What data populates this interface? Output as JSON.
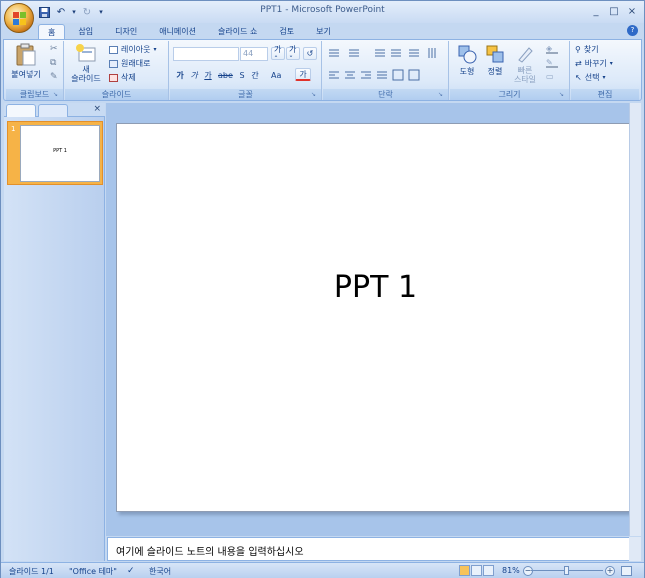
{
  "window": {
    "title": "PPT1 - Microsoft PowerPoint",
    "controls": {
      "minimize": "_",
      "maximize": "□",
      "close": "×"
    }
  },
  "qat": {
    "save": "save-icon",
    "undo": "↶",
    "undo_arrow": "▾",
    "redo": "↻",
    "customize": "▾"
  },
  "tabs": [
    {
      "label": "홈",
      "active": true
    },
    {
      "label": "삽입"
    },
    {
      "label": "디자인"
    },
    {
      "label": "애니메이션"
    },
    {
      "label": "슬라이드 쇼"
    },
    {
      "label": "검토"
    },
    {
      "label": "보기"
    }
  ],
  "help": "?",
  "ribbon": {
    "clipboard": {
      "label": "클립보드",
      "paste": "붙여넣기",
      "cut": "✂",
      "copy": "⧉",
      "format_painter": "✎"
    },
    "slides": {
      "label": "슬라이드",
      "new_slide_1": "새",
      "new_slide_2": "슬라이드",
      "layout": "레이아웃",
      "reset": "원래대로",
      "delete": "삭제"
    },
    "font": {
      "label": "글꼴",
      "font_name": "",
      "font_size": "44",
      "grow": "가ˆ",
      "shrink": "가ˇ",
      "clear": "↺",
      "bold": "가",
      "italic": "가",
      "underline": "가",
      "strike": "abe",
      "shadow": "S",
      "spacing": "간",
      "case": "Aa",
      "color": "가"
    },
    "paragraph": {
      "label": "단락"
    },
    "drawing": {
      "label": "그리기",
      "shapes": "도형",
      "arrange": "정렬",
      "quick_styles_1": "빠른",
      "quick_styles_2": "스타일"
    },
    "editing": {
      "label": "편집",
      "find": "찾기",
      "replace": "바꾸기",
      "select": "선택"
    }
  },
  "slides_pane": {
    "close": "×",
    "thumb_number": "1",
    "thumb_text": "PPT 1"
  },
  "slide": {
    "title": "PPT 1"
  },
  "notes": {
    "placeholder": "여기에 슬라이드 노트의 내용을 입력하십시오"
  },
  "status": {
    "slide_count": "슬라이드 1/1",
    "theme": "\"Office 테마\"",
    "language": "한국어",
    "zoom": "81%",
    "zoom_out": "−",
    "zoom_in": "+"
  }
}
